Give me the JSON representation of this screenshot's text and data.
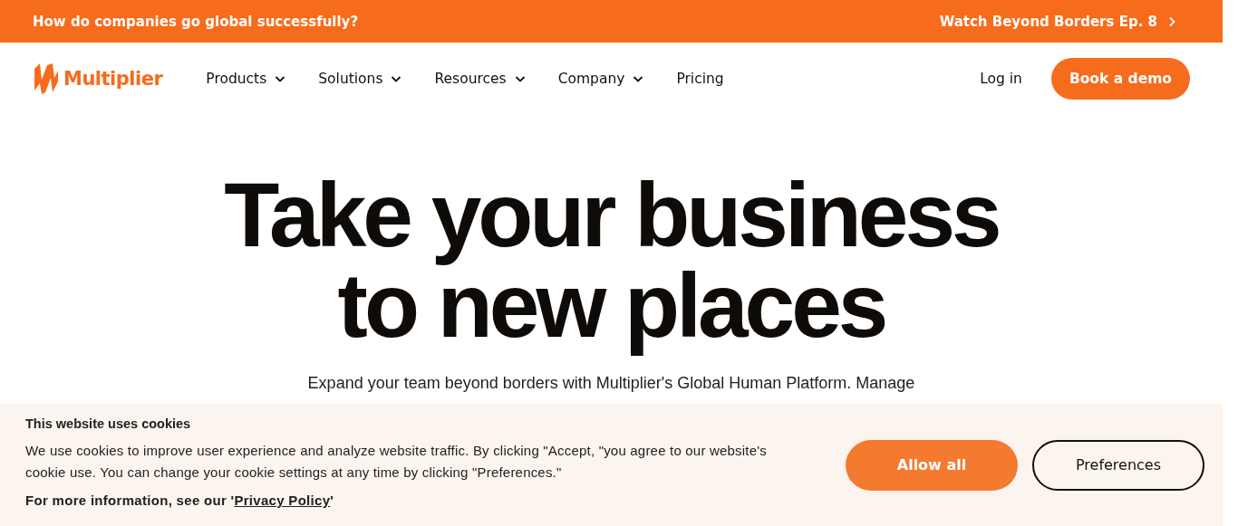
{
  "announcement": {
    "text": "How do companies go global successfully?",
    "link": "Watch Beyond Borders Ep. 8"
  },
  "nav": {
    "logo": "Multiplier",
    "items": [
      {
        "label": "Products",
        "has_menu": true
      },
      {
        "label": "Solutions",
        "has_menu": true
      },
      {
        "label": "Resources",
        "has_menu": true
      },
      {
        "label": "Company",
        "has_menu": true
      },
      {
        "label": "Pricing",
        "has_menu": false
      }
    ],
    "login": "Log in",
    "cta": "Book a demo"
  },
  "hero": {
    "headline": [
      "Take your business",
      "to new places"
    ],
    "subtitle": "Expand your team beyond borders with Multiplier's Global Human Platform. Manage"
  },
  "cookie_banner": {
    "title": "This website uses cookies",
    "body": "We use cookies to improve user experience and analyze website traffic. By clicking \"Accept, \"you agree to our website's cookie use. You can change your cookie settings at any time by clicking \"Preferences.\"",
    "more_info": "For more information, see our '",
    "link": "Privacy Policy",
    "more_info_end": "'",
    "buttons": [
      {
        "label": "Allow all",
        "kind": "primary"
      },
      {
        "label": "Preferences",
        "kind": "outline"
      }
    ]
  }
}
